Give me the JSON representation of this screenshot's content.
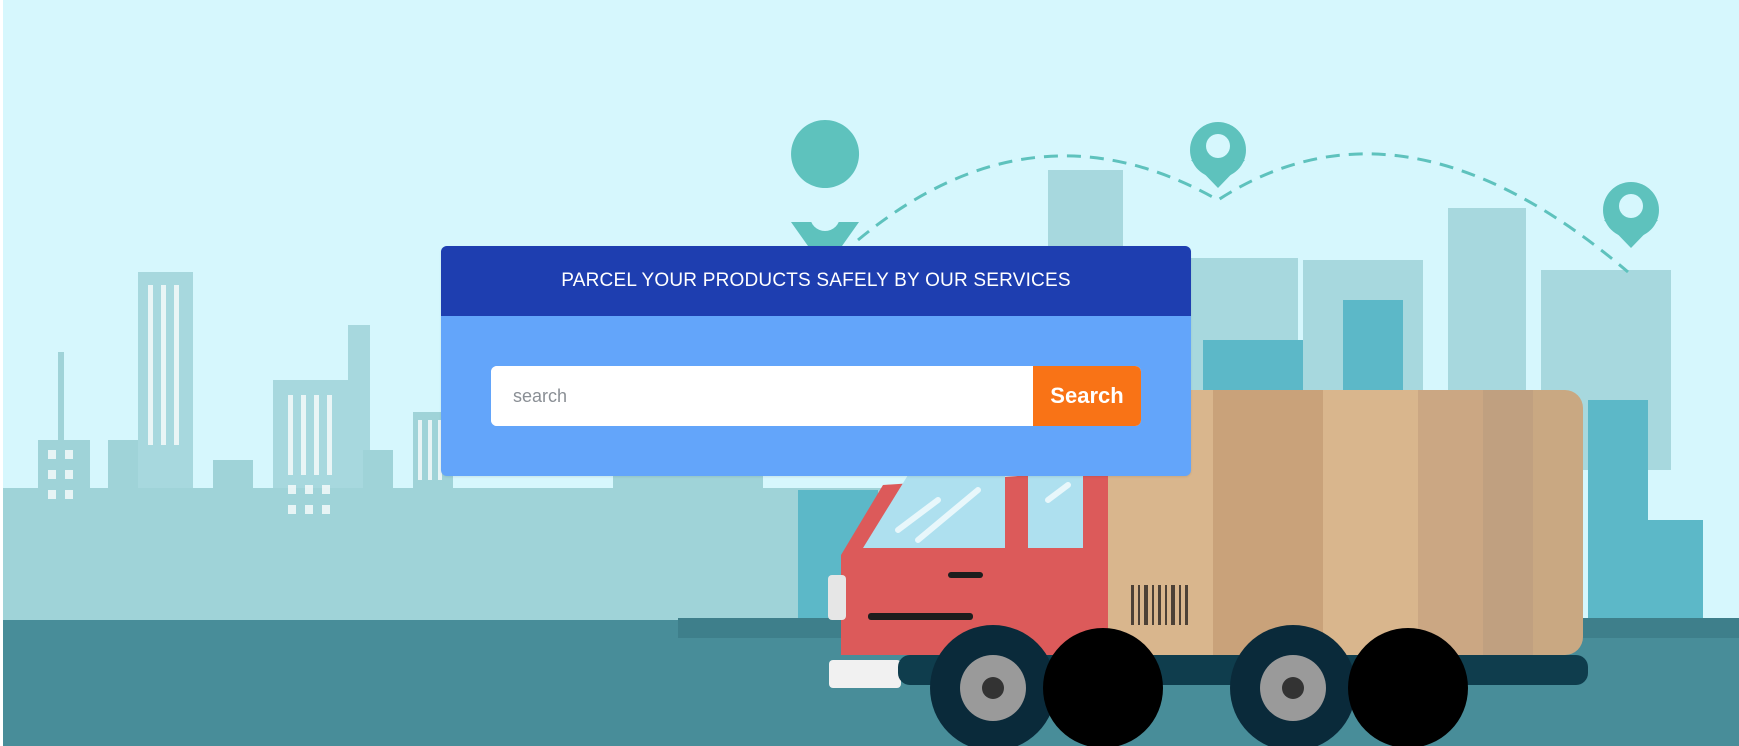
{
  "hero": {
    "heading": "PARCEL YOUR PRODUCTS SAFELY BY OUR SERVICES",
    "background_color": "#d6f7fd",
    "header_color": "#1e3eb0",
    "card_color": "#63a5fa",
    "accent_color": "#f97316"
  },
  "search": {
    "placeholder": "search",
    "value": "",
    "button_label": "Search"
  },
  "illustration": {
    "icons": [
      "map-pin-icon",
      "map-pin-icon",
      "map-pin-icon",
      "truck-icon",
      "parcel-box-icon",
      "barcode-icon"
    ]
  }
}
